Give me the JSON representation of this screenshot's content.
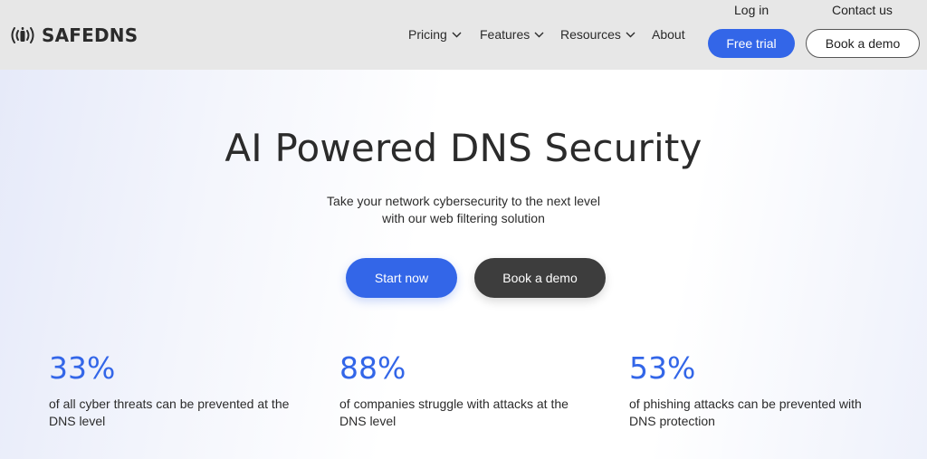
{
  "brand": {
    "name": "SAFEDNS",
    "logo_icon": "broadcast-icon"
  },
  "top_links": {
    "login": "Log in",
    "contact": "Contact us"
  },
  "nav": [
    {
      "label": "Pricing",
      "has_dropdown": true
    },
    {
      "label": "Features",
      "has_dropdown": true
    },
    {
      "label": "Resources",
      "has_dropdown": true
    },
    {
      "label": "About",
      "has_dropdown": false
    }
  ],
  "header_buttons": {
    "free_trial": "Free trial",
    "book_demo": "Book a demo"
  },
  "hero": {
    "title": "AI Powered DNS Security",
    "subtitle_line1": "Take your network cybersecurity to the next level",
    "subtitle_line2": "with our web filtering solution",
    "primary_cta": "Start now",
    "secondary_cta": "Book a demo"
  },
  "stats": [
    {
      "value": "33%",
      "line1": "of all cyber threats can be prevented at the",
      "line2": "DNS level"
    },
    {
      "value": "88%",
      "line1": "of companies struggle with attacks at the",
      "line2": "DNS level"
    },
    {
      "value": "53%",
      "line1": "of phishing attacks can be prevented with",
      "line2": "DNS protection"
    }
  ],
  "colors": {
    "accent": "#3366e8",
    "dark_button": "#3d3d3d",
    "header_bg": "#e7e7e7",
    "text": "#2b2b2b"
  }
}
